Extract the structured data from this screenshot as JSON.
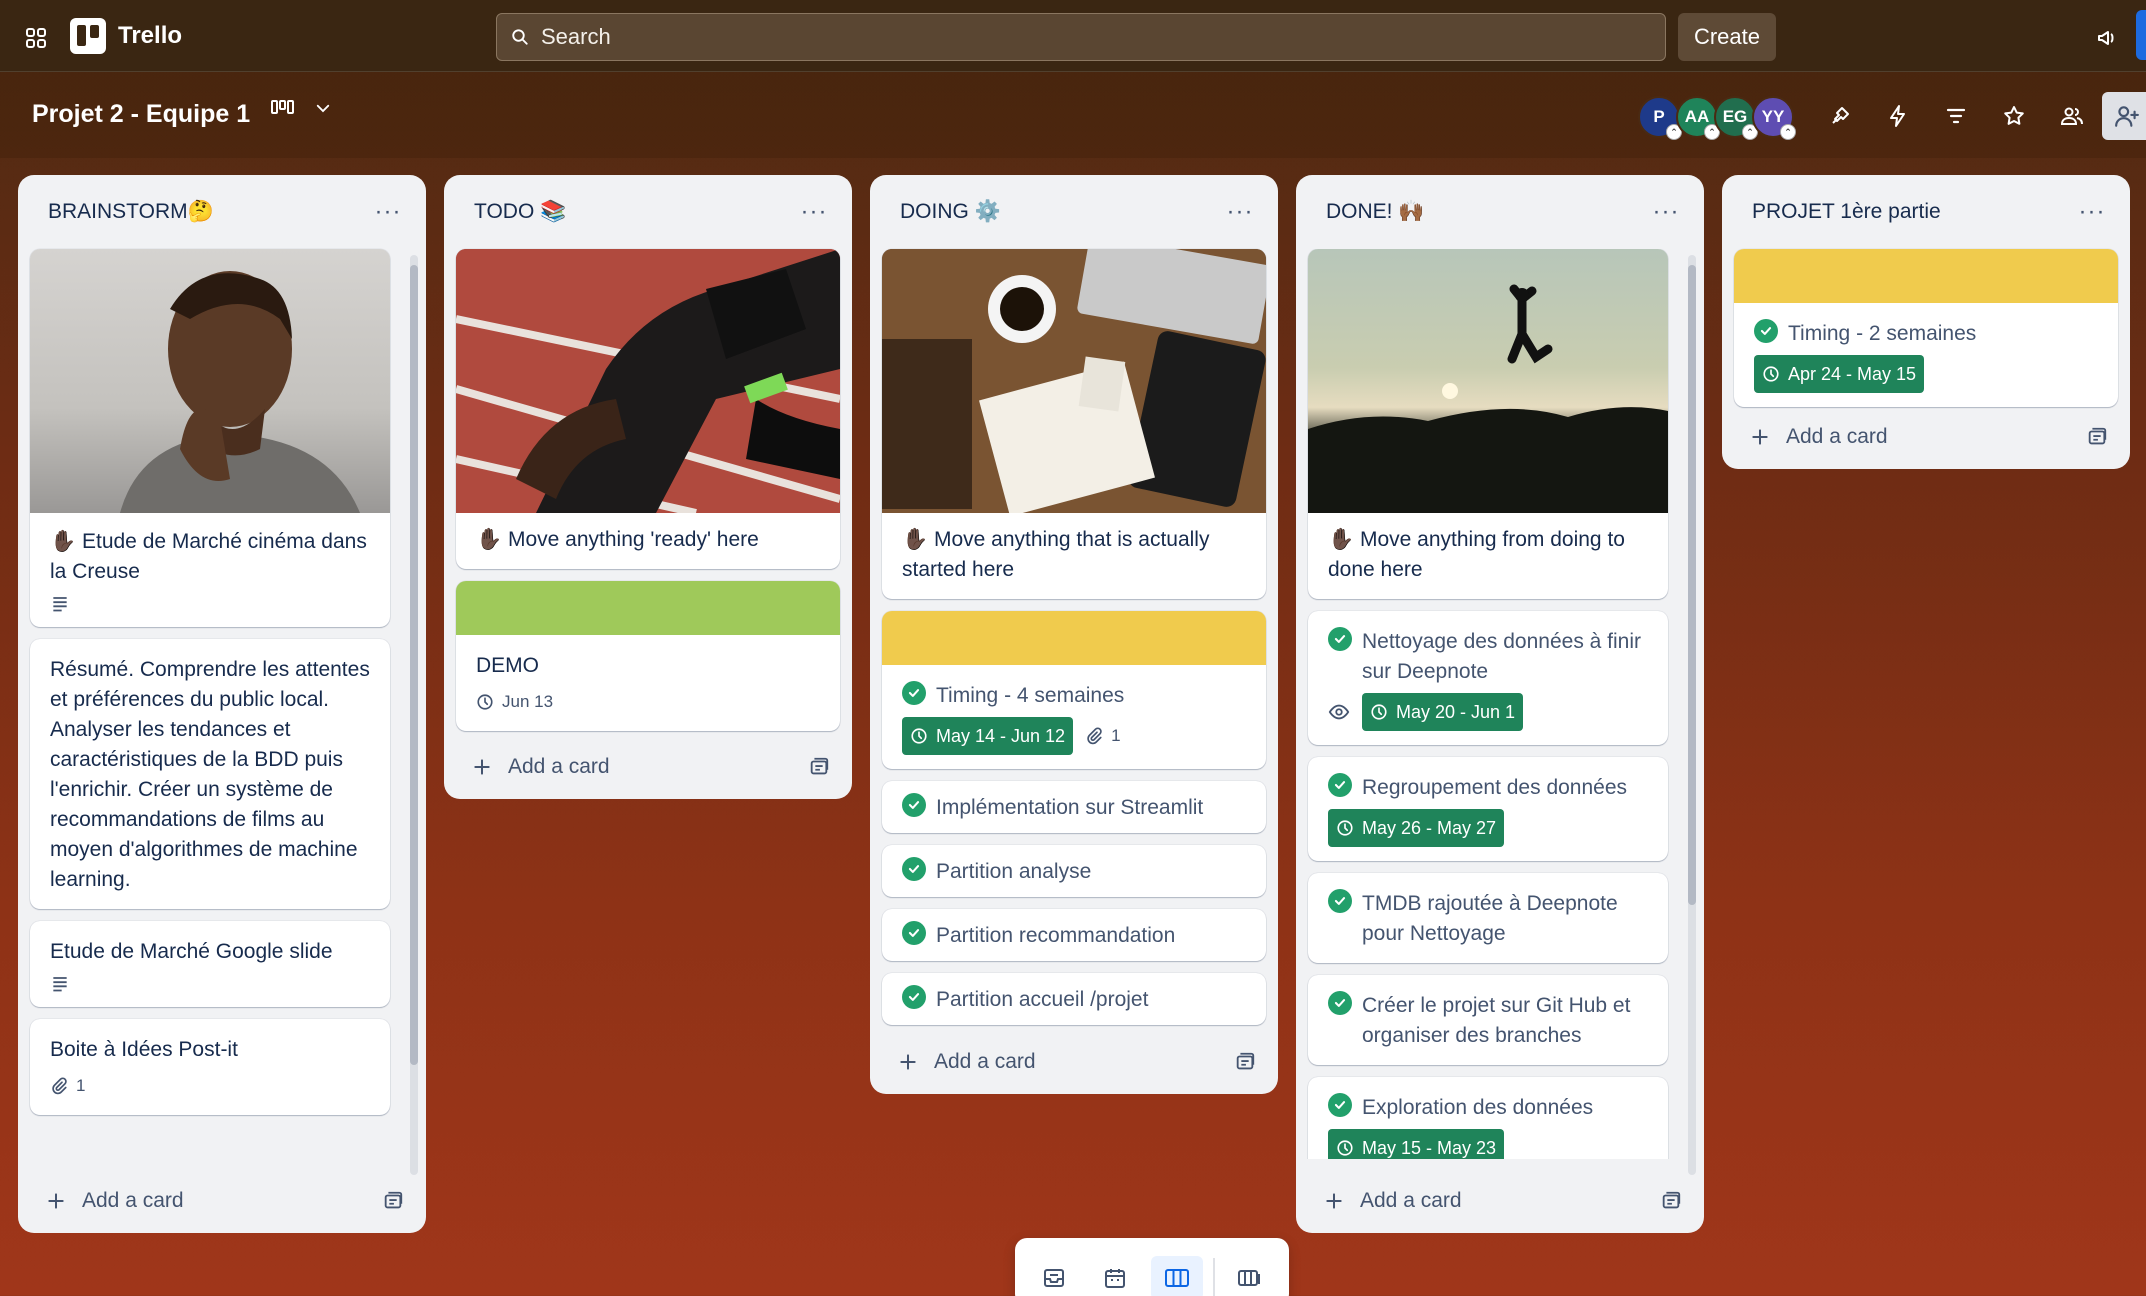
{
  "nav": {
    "app_name": "Trello",
    "search_placeholder": "Search",
    "create_label": "Create"
  },
  "board": {
    "title": "Projet 2 - Equipe 1",
    "members": [
      {
        "initials": "P",
        "color": "#1e3a8a"
      },
      {
        "initials": "AA",
        "color": "#1f845a"
      },
      {
        "initials": "EG",
        "color": "#216e4e"
      },
      {
        "initials": "YY",
        "color": "#5e4db2"
      }
    ]
  },
  "lists": [
    {
      "title": "BRAINSTORM🤔",
      "cards": [
        {
          "type": "image",
          "image": "woman-thinking",
          "title": "✋🏿 Etude de Marché cinéma dans la Creuse",
          "has_description": true
        },
        {
          "type": "text",
          "title": "Résumé. Comprendre les attentes et préférences du public local. Analyser les tendances et caractéristiques de la BDD puis l'enrichir. Créer un système de recommandations de films au moyen d'algorithmes de machine learning."
        },
        {
          "type": "text",
          "title": "Etude de Marché Google slide",
          "has_description": true
        },
        {
          "type": "text",
          "title": "Boite à Idées Post-it",
          "attachments": "1"
        }
      ],
      "add_label": "Add a card"
    },
    {
      "title": "TODO 📚",
      "cards": [
        {
          "type": "image",
          "image": "runner",
          "title": "✋🏿 Move anything 'ready' here"
        },
        {
          "type": "cover",
          "cover_color": "#9fc95a",
          "title": "DEMO",
          "date": "Jun 13"
        }
      ],
      "add_label": "Add a card"
    },
    {
      "title": "DOING ⚙️",
      "cards": [
        {
          "type": "image",
          "image": "desk",
          "title": "✋🏿 Move anything that is actually started here"
        },
        {
          "type": "cover",
          "cover_color": "#f0cb4d",
          "title": "Timing - 4 semaines",
          "done": true,
          "date": "May 14 - Jun 12",
          "attachments": "1"
        },
        {
          "type": "text",
          "title": "Implémentation sur Streamlit",
          "done": true
        },
        {
          "type": "text",
          "title": "Partition analyse",
          "done": true
        },
        {
          "type": "text",
          "title": "Partition recommandation",
          "done": true
        },
        {
          "type": "text",
          "title": "Partition accueil /projet",
          "done": true
        }
      ],
      "add_label": "Add a card"
    },
    {
      "title": "DONE! 🙌🏾",
      "cards": [
        {
          "type": "image",
          "image": "jump",
          "title": "✋🏿 Move anything from doing to done here"
        },
        {
          "type": "text",
          "title": "Nettoyage des données à finir sur Deepnote",
          "done": true,
          "watch": true,
          "date": "May 20 - Jun 1"
        },
        {
          "type": "text",
          "title": "Regroupement des données",
          "done": true,
          "date": "May 26 - May 27"
        },
        {
          "type": "text",
          "title": "TMDB rajoutée à Deepnote pour Nettoyage",
          "done": true
        },
        {
          "type": "text",
          "title": "Créer le projet sur Git Hub et organiser des branches",
          "done": true
        },
        {
          "type": "text",
          "title": "Exploration des données",
          "done": true,
          "date": "May 15 - May 23"
        }
      ],
      "add_label": "Add a card"
    },
    {
      "title": "PROJET 1ère partie",
      "cards": [
        {
          "type": "cover",
          "cover_color": "#f0cb4d",
          "title": "Timing - 2 semaines",
          "done": true,
          "date": "Apr 24 - May 15"
        }
      ],
      "add_label": "Add a card"
    }
  ]
}
